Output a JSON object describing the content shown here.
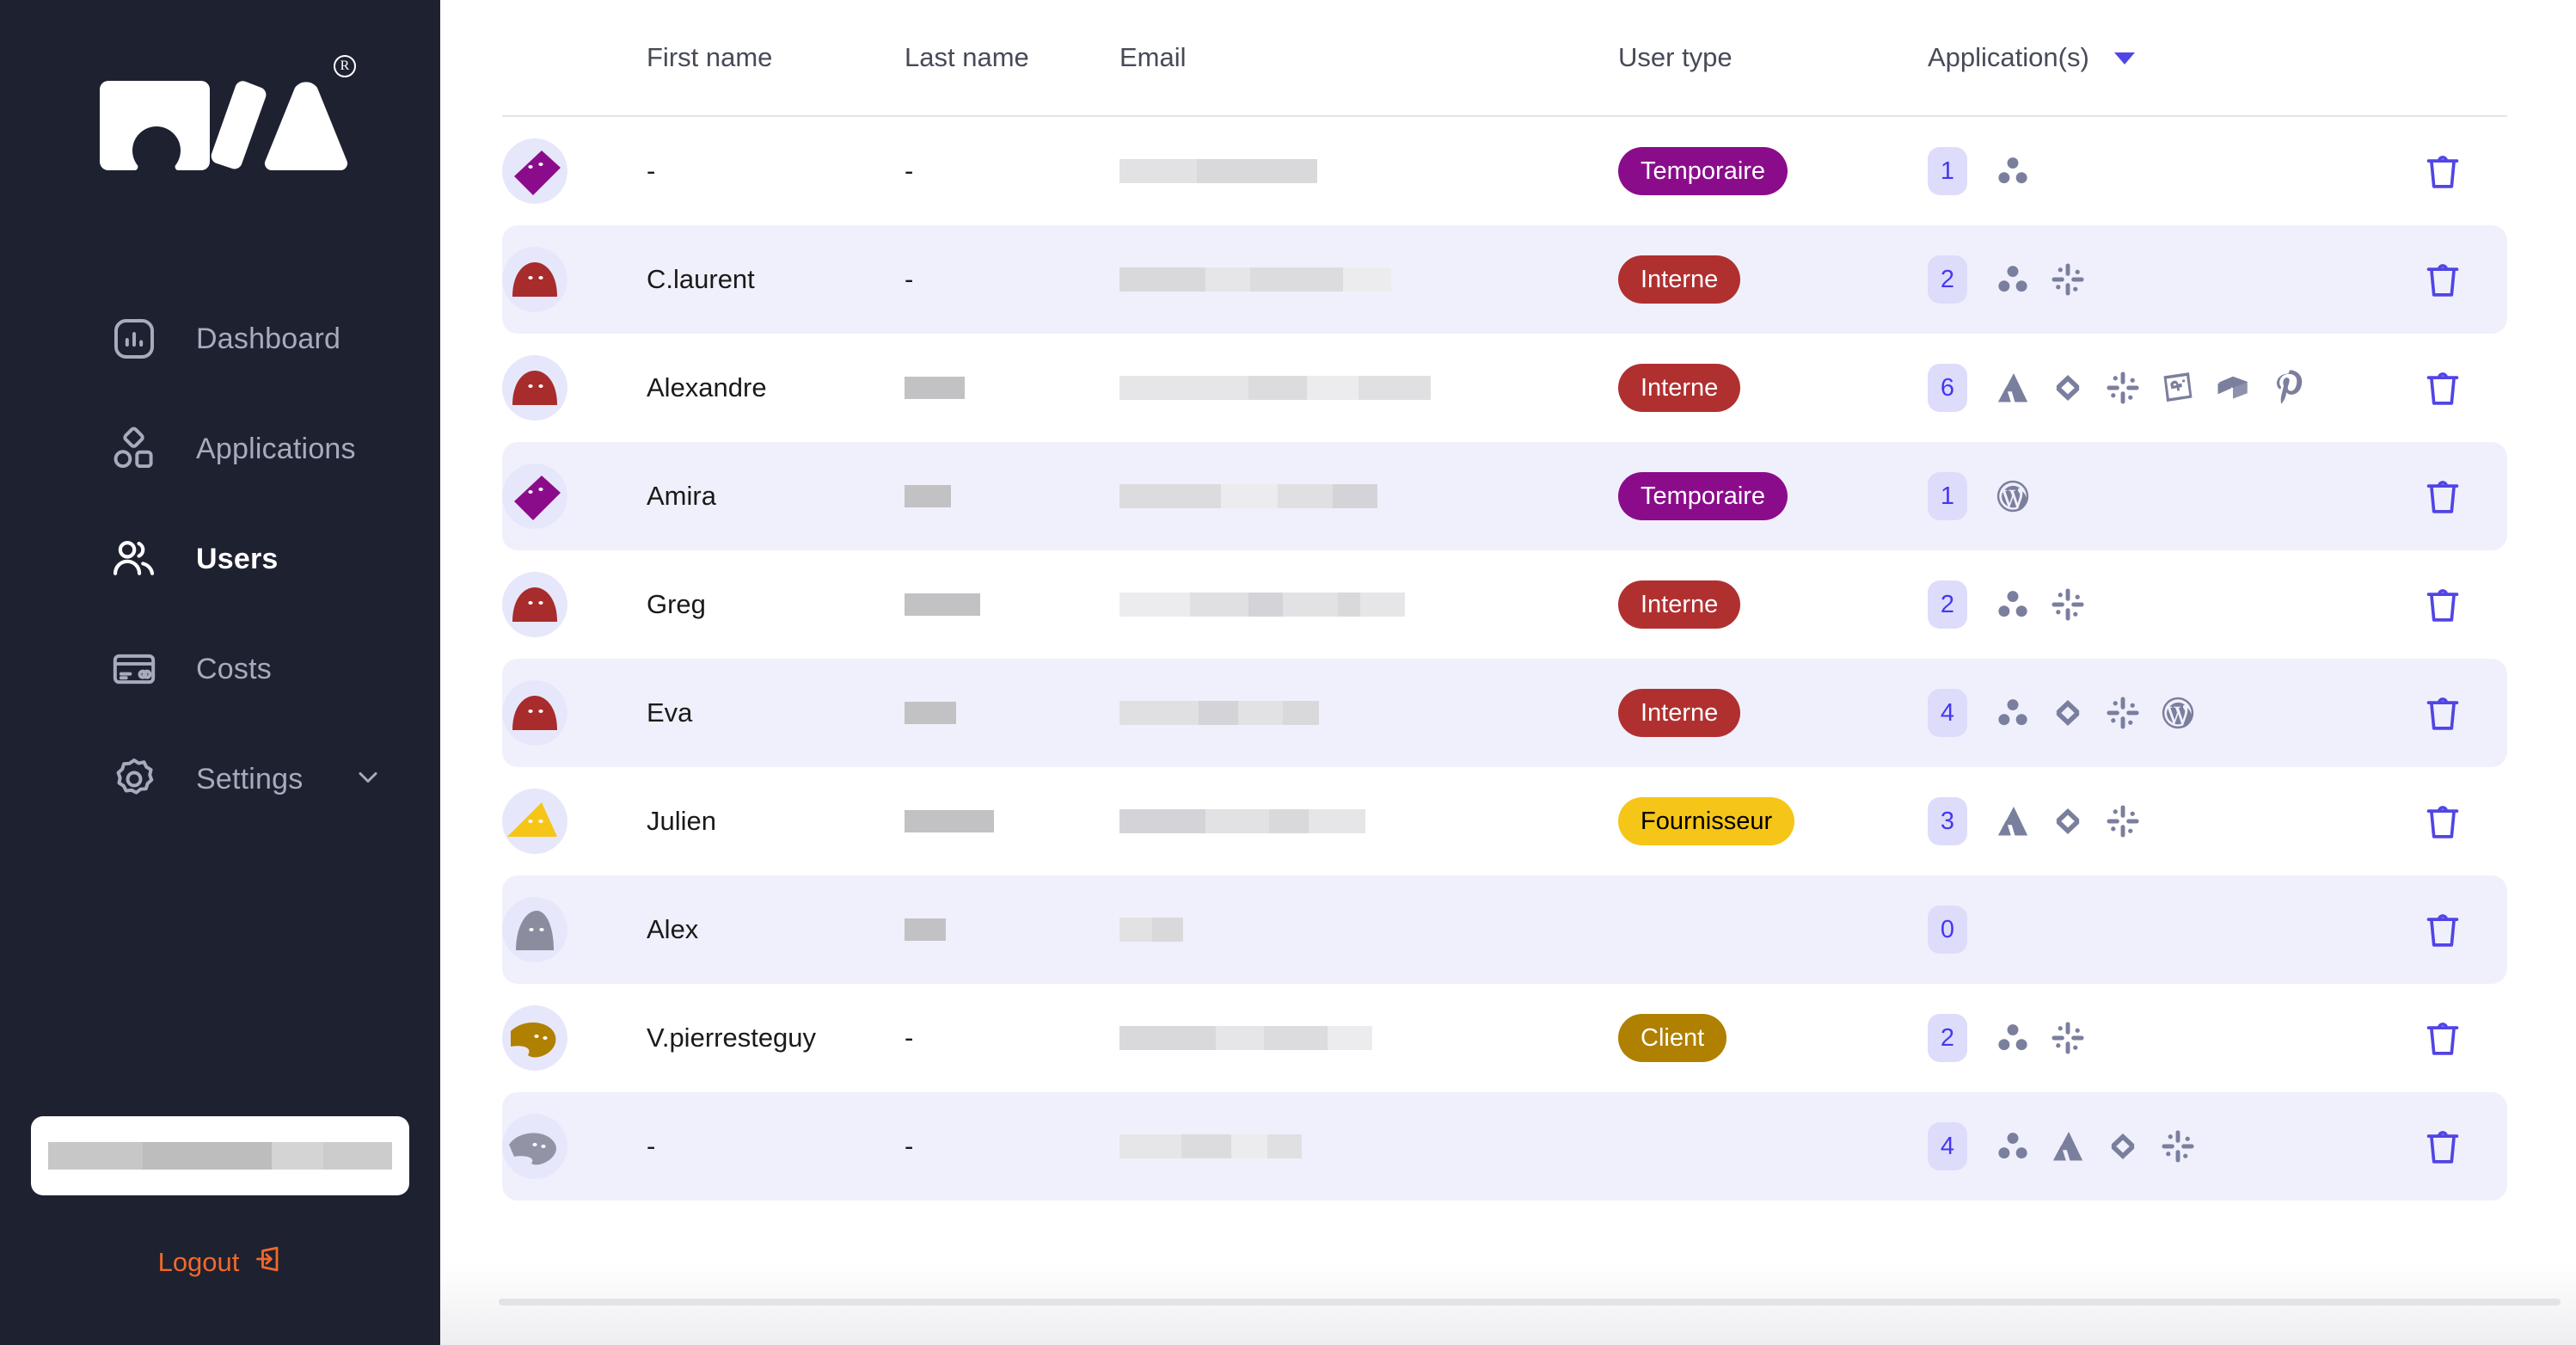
{
  "sidebar": {
    "logo": {
      "name": "app-logo",
      "reg_symbol": "R"
    },
    "items": [
      {
        "label": "Dashboard",
        "icon": "chart-bar-icon",
        "active": false,
        "chevron": false
      },
      {
        "label": "Applications",
        "icon": "shapes-icon",
        "active": false,
        "chevron": false
      },
      {
        "label": "Users",
        "icon": "users-icon",
        "active": true,
        "chevron": false
      },
      {
        "label": "Costs",
        "icon": "credit-card-icon",
        "active": false,
        "chevron": false
      },
      {
        "label": "Settings",
        "icon": "gear-icon",
        "active": false,
        "chevron": true
      }
    ],
    "user_card": {
      "redacted": true,
      "label": ""
    },
    "logout": {
      "label": "Logout",
      "icon": "logout-icon",
      "color": "#f0682a"
    }
  },
  "table": {
    "headers": {
      "avatar": "",
      "first_name": "First name",
      "last_name": "Last name",
      "email": "Email",
      "user_type": "User type",
      "applications": "Application(s)",
      "delete": ""
    },
    "sort_caret": "▼",
    "rows": [
      {
        "first_name": "-",
        "last_name": "-",
        "email_redacted": true,
        "user_type": "Temporaire",
        "app_count": "1",
        "apps": [
          "asana-icon"
        ],
        "avatar_color": "#8b0c8b"
      },
      {
        "first_name": "C.laurent",
        "last_name": "-",
        "email_redacted": true,
        "user_type": "Interne",
        "app_count": "2",
        "apps": [
          "asana-icon",
          "slack-icon"
        ],
        "avatar_color": "#a82c2c"
      },
      {
        "first_name": "Alexandre",
        "last_name": "",
        "email_redacted": true,
        "user_type": "Interne",
        "app_count": "6",
        "apps": [
          "atlassian-icon",
          "contentsquare-icon",
          "slack-icon",
          "datadog-icon",
          "box-icon",
          "pinterest-icon"
        ],
        "avatar_color": "#a82c2c"
      },
      {
        "first_name": "Amira",
        "last_name": "",
        "email_redacted": true,
        "user_type": "Temporaire",
        "app_count": "1",
        "apps": [
          "wordpress-icon"
        ],
        "avatar_color": "#8b0c8b"
      },
      {
        "first_name": "Greg",
        "last_name": "",
        "email_redacted": true,
        "user_type": "Interne",
        "app_count": "2",
        "apps": [
          "asana-icon",
          "slack-icon"
        ],
        "avatar_color": "#a82c2c"
      },
      {
        "first_name": "Eva",
        "last_name": "",
        "email_redacted": true,
        "user_type": "Interne",
        "app_count": "4",
        "apps": [
          "asana-icon",
          "contentsquare-icon",
          "slack-icon",
          "wordpress-icon"
        ],
        "avatar_color": "#a82c2c"
      },
      {
        "first_name": "Julien",
        "last_name": "",
        "email_redacted": true,
        "user_type": "Fournisseur",
        "app_count": "3",
        "apps": [
          "atlassian-icon",
          "contentsquare-icon",
          "slack-icon"
        ],
        "avatar_color": "#f5c518"
      },
      {
        "first_name": "Alex",
        "last_name": "",
        "email_redacted": true,
        "user_type": "",
        "app_count": "0",
        "apps": [],
        "avatar_color": "#8b8c9e"
      },
      {
        "first_name": "V.pierresteguy",
        "last_name": "-",
        "email_redacted": true,
        "user_type": "Client",
        "app_count": "2",
        "apps": [
          "asana-icon",
          "slack-icon"
        ],
        "avatar_color": "#b08000"
      },
      {
        "first_name": "-",
        "last_name": "-",
        "email_redacted": true,
        "user_type": "",
        "app_count": "4",
        "apps": [
          "asana-icon",
          "atlassian-icon",
          "contentsquare-icon",
          "slack-icon"
        ],
        "avatar_color": "#9293a5"
      }
    ],
    "delete_icon": "trash-icon"
  },
  "colors": {
    "sidebar_bg": "#1e2130",
    "accent_indigo": "#5145e5",
    "badge_temporaire": "#8b0c8b",
    "badge_interne": "#b03030",
    "badge_fournisseur": "#f5c518",
    "badge_client": "#b08000",
    "row_alt_bg": "#f0f0fc",
    "logout_orange": "#f0682a"
  }
}
